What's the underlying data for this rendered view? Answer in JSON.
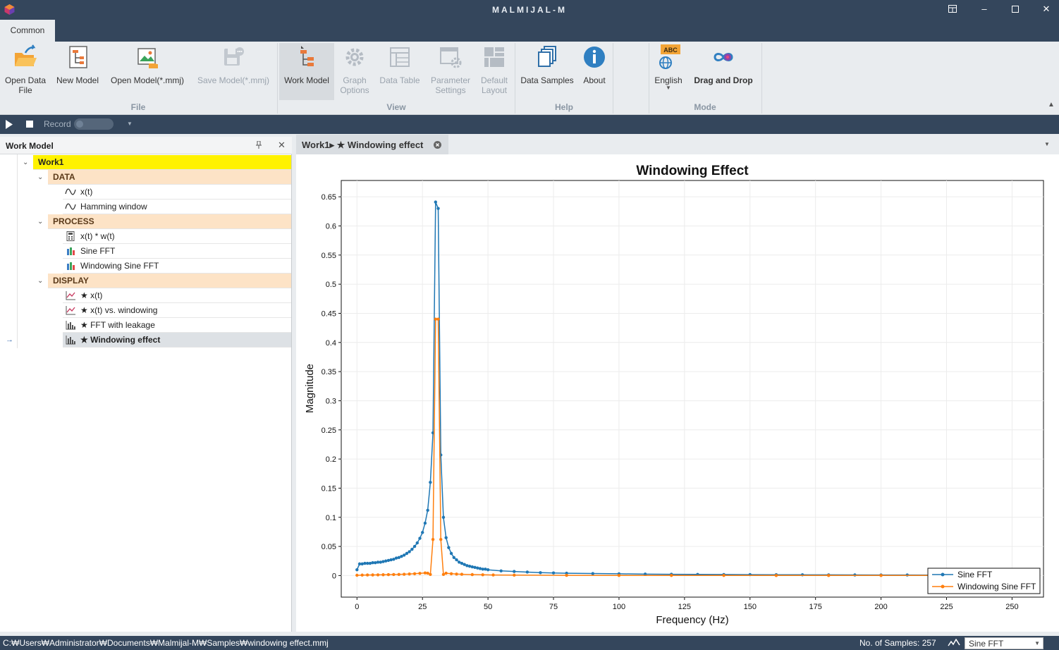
{
  "app": {
    "title": "MALMIJAL-M"
  },
  "ribbon": {
    "tab": "Common",
    "buttons": {
      "open_data_file": "Open Data\nFile",
      "new_model": "New Model",
      "open_model": "Open Model(*.mmj)",
      "save_model": "Save Model(*.mmj)",
      "work_model": "Work Model",
      "graph_options": "Graph\nOptions",
      "data_table": "Data Table",
      "parameter_settings": "Parameter\nSettings",
      "default_layout": "Default\nLayout",
      "data_samples": "Data Samples",
      "about": "About",
      "language": "English",
      "language_badge": "ABC",
      "drag_and_drop": "Drag and Drop"
    },
    "groups": {
      "file": "File",
      "view": "View",
      "help": "Help",
      "mode": "Mode"
    }
  },
  "record_bar": {
    "record_label": "Record"
  },
  "work_model_panel": {
    "title": "Work Model",
    "root": "Work1",
    "categories": {
      "data": "DATA",
      "process": "PROCESS",
      "display": "DISPLAY"
    },
    "data_items": [
      "x(t)",
      "Hamming window"
    ],
    "process_items": [
      "x(t) * w(t)",
      "Sine FFT",
      "Windowing Sine FFT"
    ],
    "display_items": [
      "★ x(t)",
      "★ x(t) vs. windowing",
      "★ FFT with leakage",
      "★ Windowing effect"
    ]
  },
  "doc_tab": {
    "label": "Work1▸ ★ Windowing effect"
  },
  "chart_data": {
    "type": "line",
    "title": "Windowing Effect",
    "xlabel": "Frequency (Hz)",
    "ylabel": "Magnitude",
    "xlim": [
      -6,
      262
    ],
    "ylim": [
      -0.037,
      0.678
    ],
    "xticks": [
      "0",
      "25",
      "50",
      "75",
      "100",
      "125",
      "150",
      "175",
      "200",
      "225",
      "250"
    ],
    "yticks": [
      "0",
      "0.05",
      "0.1",
      "0.15",
      "0.2",
      "0.25",
      "0.3",
      "0.35",
      "0.4",
      "0.45",
      "0.5",
      "0.55",
      "0.6",
      "0.65"
    ],
    "grid": true,
    "legend_position": "bottom-right",
    "series": [
      {
        "name": "Sine FFT",
        "color": "#1f77b4",
        "x": [
          0,
          1,
          2,
          3,
          4,
          5,
          6,
          7,
          8,
          9,
          10,
          11,
          12,
          13,
          14,
          15,
          16,
          17,
          18,
          19,
          20,
          21,
          22,
          23,
          24,
          25,
          26,
          27,
          28,
          29,
          30,
          31,
          32,
          33,
          34,
          35,
          36,
          37,
          38,
          39,
          40,
          41,
          42,
          43,
          44,
          45,
          46,
          47,
          48,
          49,
          50,
          55,
          60,
          65,
          70,
          75,
          80,
          90,
          100,
          110,
          120,
          130,
          140,
          150,
          160,
          170,
          180,
          190,
          200,
          210,
          220,
          230,
          240,
          250,
          256
        ],
        "y": [
          0.01,
          0.02,
          0.02,
          0.021,
          0.021,
          0.021,
          0.022,
          0.022,
          0.023,
          0.023,
          0.024,
          0.025,
          0.026,
          0.027,
          0.028,
          0.03,
          0.031,
          0.033,
          0.035,
          0.038,
          0.041,
          0.045,
          0.05,
          0.056,
          0.064,
          0.074,
          0.09,
          0.112,
          0.16,
          0.245,
          0.641,
          0.63,
          0.207,
          0.1,
          0.065,
          0.048,
          0.038,
          0.031,
          0.027,
          0.023,
          0.021,
          0.019,
          0.017,
          0.016,
          0.015,
          0.014,
          0.013,
          0.012,
          0.011,
          0.011,
          0.01,
          0.008,
          0.007,
          0.006,
          0.005,
          0.0045,
          0.004,
          0.0035,
          0.003,
          0.0025,
          0.0022,
          0.002,
          0.0018,
          0.0016,
          0.0015,
          0.0013,
          0.0012,
          0.0011,
          0.001,
          0.001,
          0.0009,
          0.0008,
          0.0008,
          0.0007,
          0.0007
        ]
      },
      {
        "name": "Windowing Sine FFT",
        "color": "#ff7f0e",
        "x": [
          0,
          2,
          4,
          6,
          8,
          10,
          12,
          14,
          16,
          18,
          20,
          22,
          24,
          26,
          27,
          28,
          29,
          30,
          31,
          32,
          33,
          34,
          36,
          38,
          40,
          44,
          48,
          52,
          60,
          80,
          100,
          120,
          140,
          160,
          180,
          200,
          220,
          240,
          256
        ],
        "y": [
          0.0005,
          0.0008,
          0.001,
          0.0011,
          0.0012,
          0.0014,
          0.0016,
          0.0018,
          0.002,
          0.0023,
          0.0027,
          0.0032,
          0.0038,
          0.0045,
          0.004,
          0.002,
          0.062,
          0.44,
          0.44,
          0.062,
          0.002,
          0.004,
          0.0032,
          0.0026,
          0.0022,
          0.0017,
          0.0013,
          0.001,
          0.0007,
          0.0004,
          0.0003,
          0.0002,
          0.0002,
          0.0001,
          0.0001,
          0.0001,
          0.0001,
          0.0001,
          0.0001
        ]
      }
    ]
  },
  "status": {
    "path": "C:₩Users₩Administrator₩Documents₩Malmijal-M₩Samples₩windowing effect.mmj",
    "samples": "No. of Samples: 257",
    "selected_series": "Sine FFT"
  }
}
